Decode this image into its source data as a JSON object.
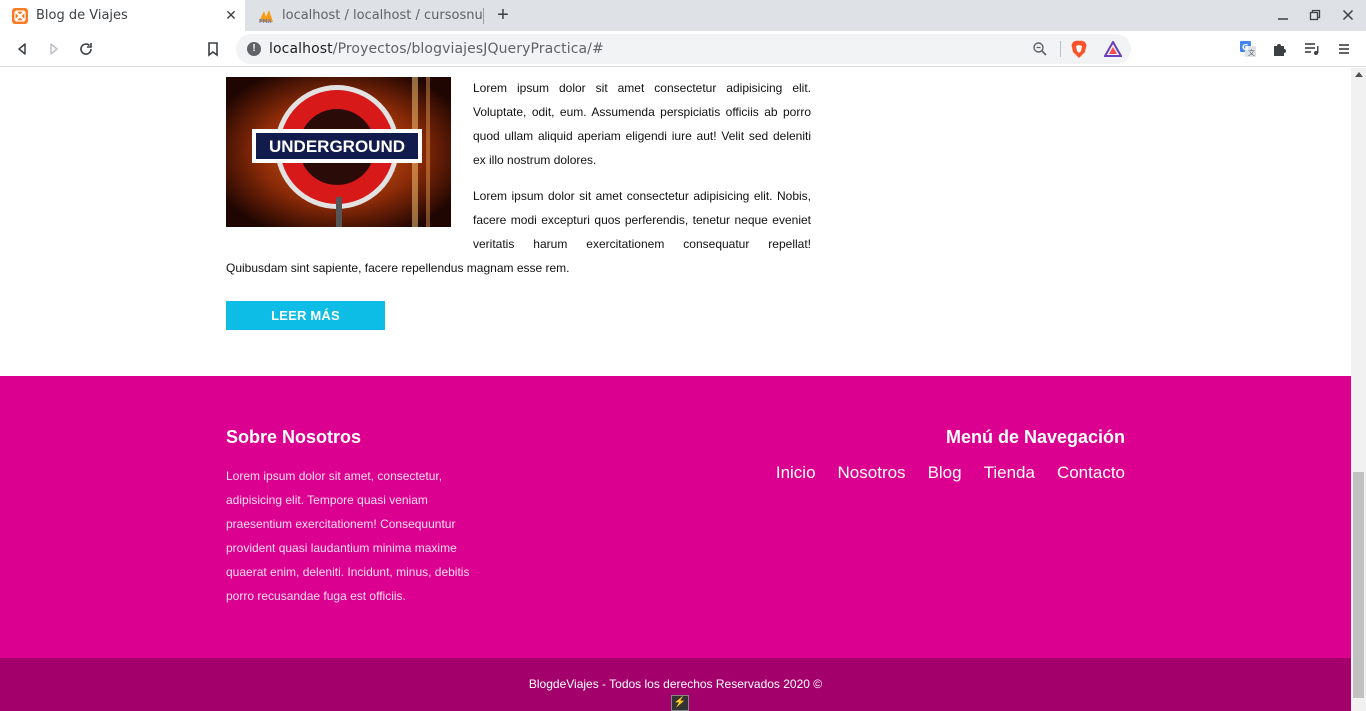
{
  "browser": {
    "tabs": [
      {
        "title": "Blog de Viajes",
        "active": true,
        "favicon": "xampp-icon"
      },
      {
        "title": "localhost / localhost / cursosnu",
        "active": false,
        "favicon": "phpmyadmin-icon"
      }
    ],
    "url_host": "localhost",
    "url_path": "/Proyectos/blogviajesJQueryPractica/#"
  },
  "post": {
    "image_label": "UNDERGROUND",
    "paragraph_1": "Lorem ipsum dolor sit amet consectetur adipisicing elit. Voluptate, odit, eum. Assumenda perspiciatis officiis ab porro quod ullam aliquid aperiam eligendi iure aut! Velit sed deleniti ex illo nostrum dolores.",
    "paragraph_2": "Lorem ipsum dolor sit amet consectetur adipisicing elit. Nobis, facere modi excepturi quos perferendis, tenetur neque eveniet veritatis harum exercitationem consequatur repellat! Quibusdam sint sapiente, facere repellendus magnam esse rem.",
    "read_more": "LEER MÁS"
  },
  "footer": {
    "about_title": "Sobre Nosotros",
    "about_text": "Lorem ipsum dolor sit amet, consectetur, adipisicing elit. Tempore quasi veniam praesentium exercitationem! Consequuntur provident quasi laudantium minima maxime quaerat enim, deleniti. Incidunt, minus, debitis porro recusandae fuga est officiis.",
    "nav_title": "Menú de Navegación",
    "nav_items": [
      "Inicio",
      "Nosotros",
      "Blog",
      "Tienda",
      "Contacto"
    ],
    "copyright": "BlogdeViajes - Todos los derechos Reservados 2020 ©"
  },
  "colors": {
    "footer_bg": "#db008f",
    "bottombar_bg": "#a3006c",
    "button_bg": "#0dbde5"
  }
}
